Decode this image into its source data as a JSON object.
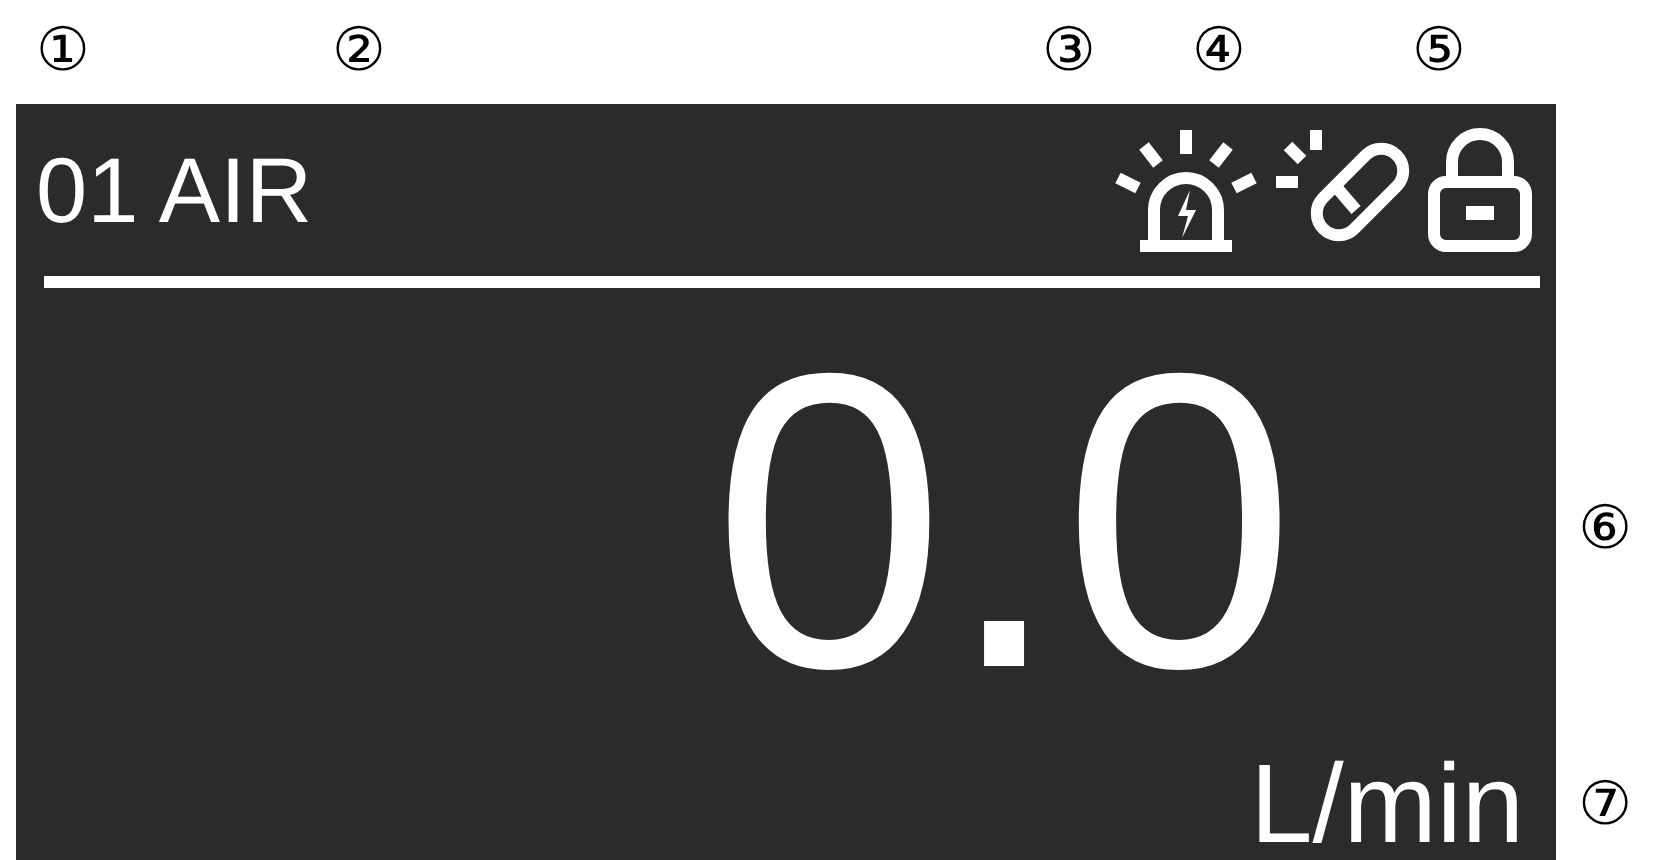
{
  "callouts": [
    "①",
    "②",
    "③",
    "④",
    "⑤",
    "⑥",
    "⑦"
  ],
  "display": {
    "channel": "01",
    "gas": "AIR",
    "value": "0.0",
    "unit": "L/min"
  }
}
